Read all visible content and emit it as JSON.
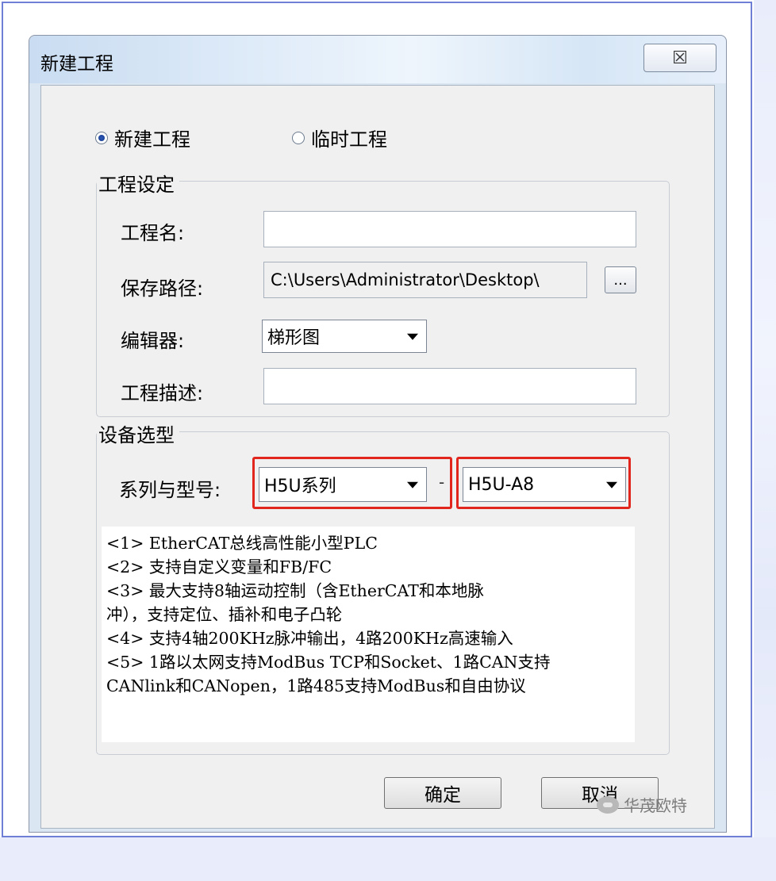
{
  "dialog": {
    "title": "新建工程",
    "close_label": "☒"
  },
  "project_type": {
    "options": [
      {
        "label": "新建工程",
        "selected": true
      },
      {
        "label": "临时工程",
        "selected": false
      }
    ]
  },
  "project_settings": {
    "group_title": "工程设定",
    "name_label": "工程名:",
    "name_value": "",
    "path_label": "保存路径:",
    "path_value": "C:\\Users\\Administrator\\Desktop\\",
    "browse_label": "...",
    "editor_label": "编辑器:",
    "editor_value": "梯形图",
    "description_label": "工程描述:",
    "description_value": ""
  },
  "device_selection": {
    "group_title": "设备选型",
    "series_model_label": "系列与型号:",
    "series_value": "H5U系列",
    "separator": "-",
    "model_value": "H5U-A8",
    "description_lines": [
      "<1> EtherCAT总线高性能小型PLC",
      "<2> 支持自定义变量和FB/FC",
      "<3> 最大支持8轴运动控制（含EtherCAT和本地脉",
      "冲），支持定位、插补和电子凸轮",
      "<4> 支持4轴200KHz脉冲输出，4路200KHz高速输入",
      "<5> 1路以太网支持ModBus TCP和Socket、1路CAN支持",
      "CANlink和CANopen，1路485支持ModBus和自由协议"
    ]
  },
  "buttons": {
    "ok_label": "确定",
    "cancel_label": "取消"
  },
  "watermark": {
    "text": "华茂欧特"
  },
  "colors": {
    "highlight_box": "#e0261d",
    "frame_border": "#6f7fd6"
  }
}
